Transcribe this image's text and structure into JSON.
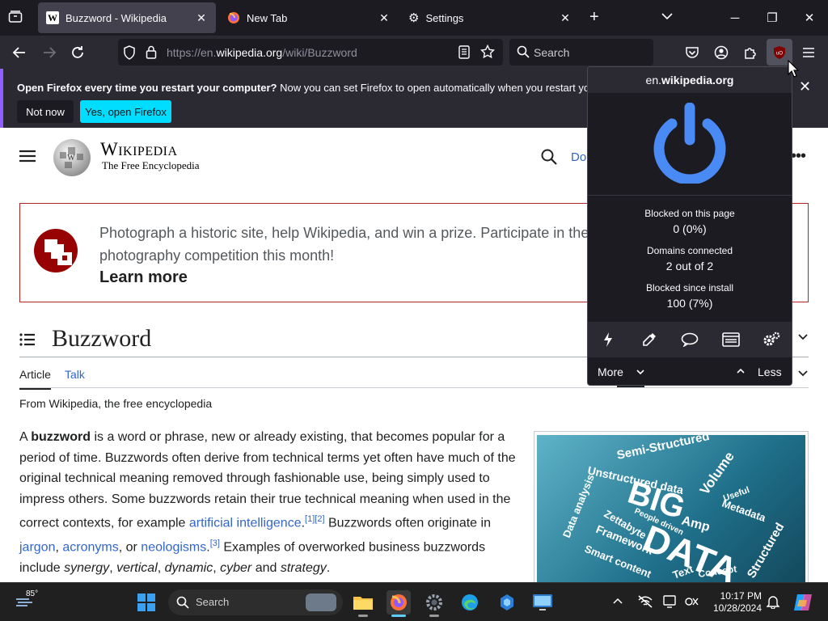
{
  "browser": {
    "tabs": [
      {
        "label": "Buzzword - Wikipedia",
        "icon": "wikipedia-icon",
        "active": true
      },
      {
        "label": "New Tab",
        "icon": "firefox-icon",
        "active": false
      },
      {
        "label": "Settings",
        "icon": "gear-icon",
        "active": false
      }
    ],
    "new_tab_symbol": "+",
    "url": {
      "prefix": "https://en.",
      "domain": "wikipedia.org",
      "suffix": "/wiki/Buzzword"
    },
    "search_placeholder": "Search"
  },
  "notification": {
    "bold": "Open Firefox every time you restart your computer?",
    "text": " Now you can set Firefox to open automatically when you restart your device.",
    "not_now": "Not now",
    "yes": "Yes, open Firefox"
  },
  "wikipedia": {
    "wordmark": "Wikipedia",
    "tagline": "The Free Encyclopedia",
    "header_link_partial": "Do",
    "banner_text": "Photograph a historic site, help Wikipedia, and win a prize. Participate in the world's largest photography competition this month!",
    "banner_line1": "Photograph a historic site, help Wikipedia, and win a prize. Participate in the",
    "banner_line2": "photography competition this month!",
    "banner_link": "Learn more",
    "page_title": "Buzzword",
    "tab_article": "Article",
    "tab_talk": "Talk",
    "from": "From Wikipedia, the free encyclopedia",
    "para": {
      "t1": "A ",
      "bold": "buzzword",
      "t2": " is a word or phrase, new or already existing, that becomes popular for a period of time. Buzzwords often derive from technical terms yet often have much of the original technical meaning removed through fashionable use, being simply used to impress others. Some buzzwords retain their true technical meaning when used in the correct contexts, for example ",
      "link1": "artificial intelligence",
      "sup1": "[1]",
      "sup2": "[2]",
      "t3": " Buzzwords often originate in ",
      "link2": "jargon",
      "t4": ", ",
      "link3": "acronyms",
      "t5": ", or ",
      "link4": "neologisms",
      "sup3": "[3]",
      "t6": " Examples of overworked business buzzwords include ",
      "i1": "synergy",
      "i2": "vertical",
      "i3": "dynamic",
      "i4": "cyber",
      "t7": " and ",
      "i5": "strategy"
    },
    "figure_words": {
      "big": "BIG",
      "data": "DATA",
      "w1": "Semi-Structured",
      "w2": "Unstructured data",
      "w3": "Volume",
      "w4": "Metadata",
      "w5": "Data analysis",
      "w6": "Framework",
      "w7": "Smart content",
      "w8": "Useful",
      "w9": "People driven",
      "w10": "Zettabyte",
      "w11": "Structured",
      "w12": "Text",
      "w13": "Concept",
      "w14": "Amp"
    }
  },
  "ublock": {
    "hostname_prefix": "en.",
    "hostname_domain": "wikipedia.org",
    "blocked_page_label": "Blocked on this page",
    "blocked_page_value": "0 (0%)",
    "domains_label": "Domains connected",
    "domains_value": "2 out of 2",
    "blocked_install_label": "Blocked since install",
    "blocked_install_value": "100 (7%)",
    "more": "More",
    "less": "Less",
    "power_color": "#4a8af4"
  },
  "taskbar": {
    "weather": "85°",
    "search": "Search",
    "time": "10:17 PM",
    "date": "10/28/2024"
  }
}
